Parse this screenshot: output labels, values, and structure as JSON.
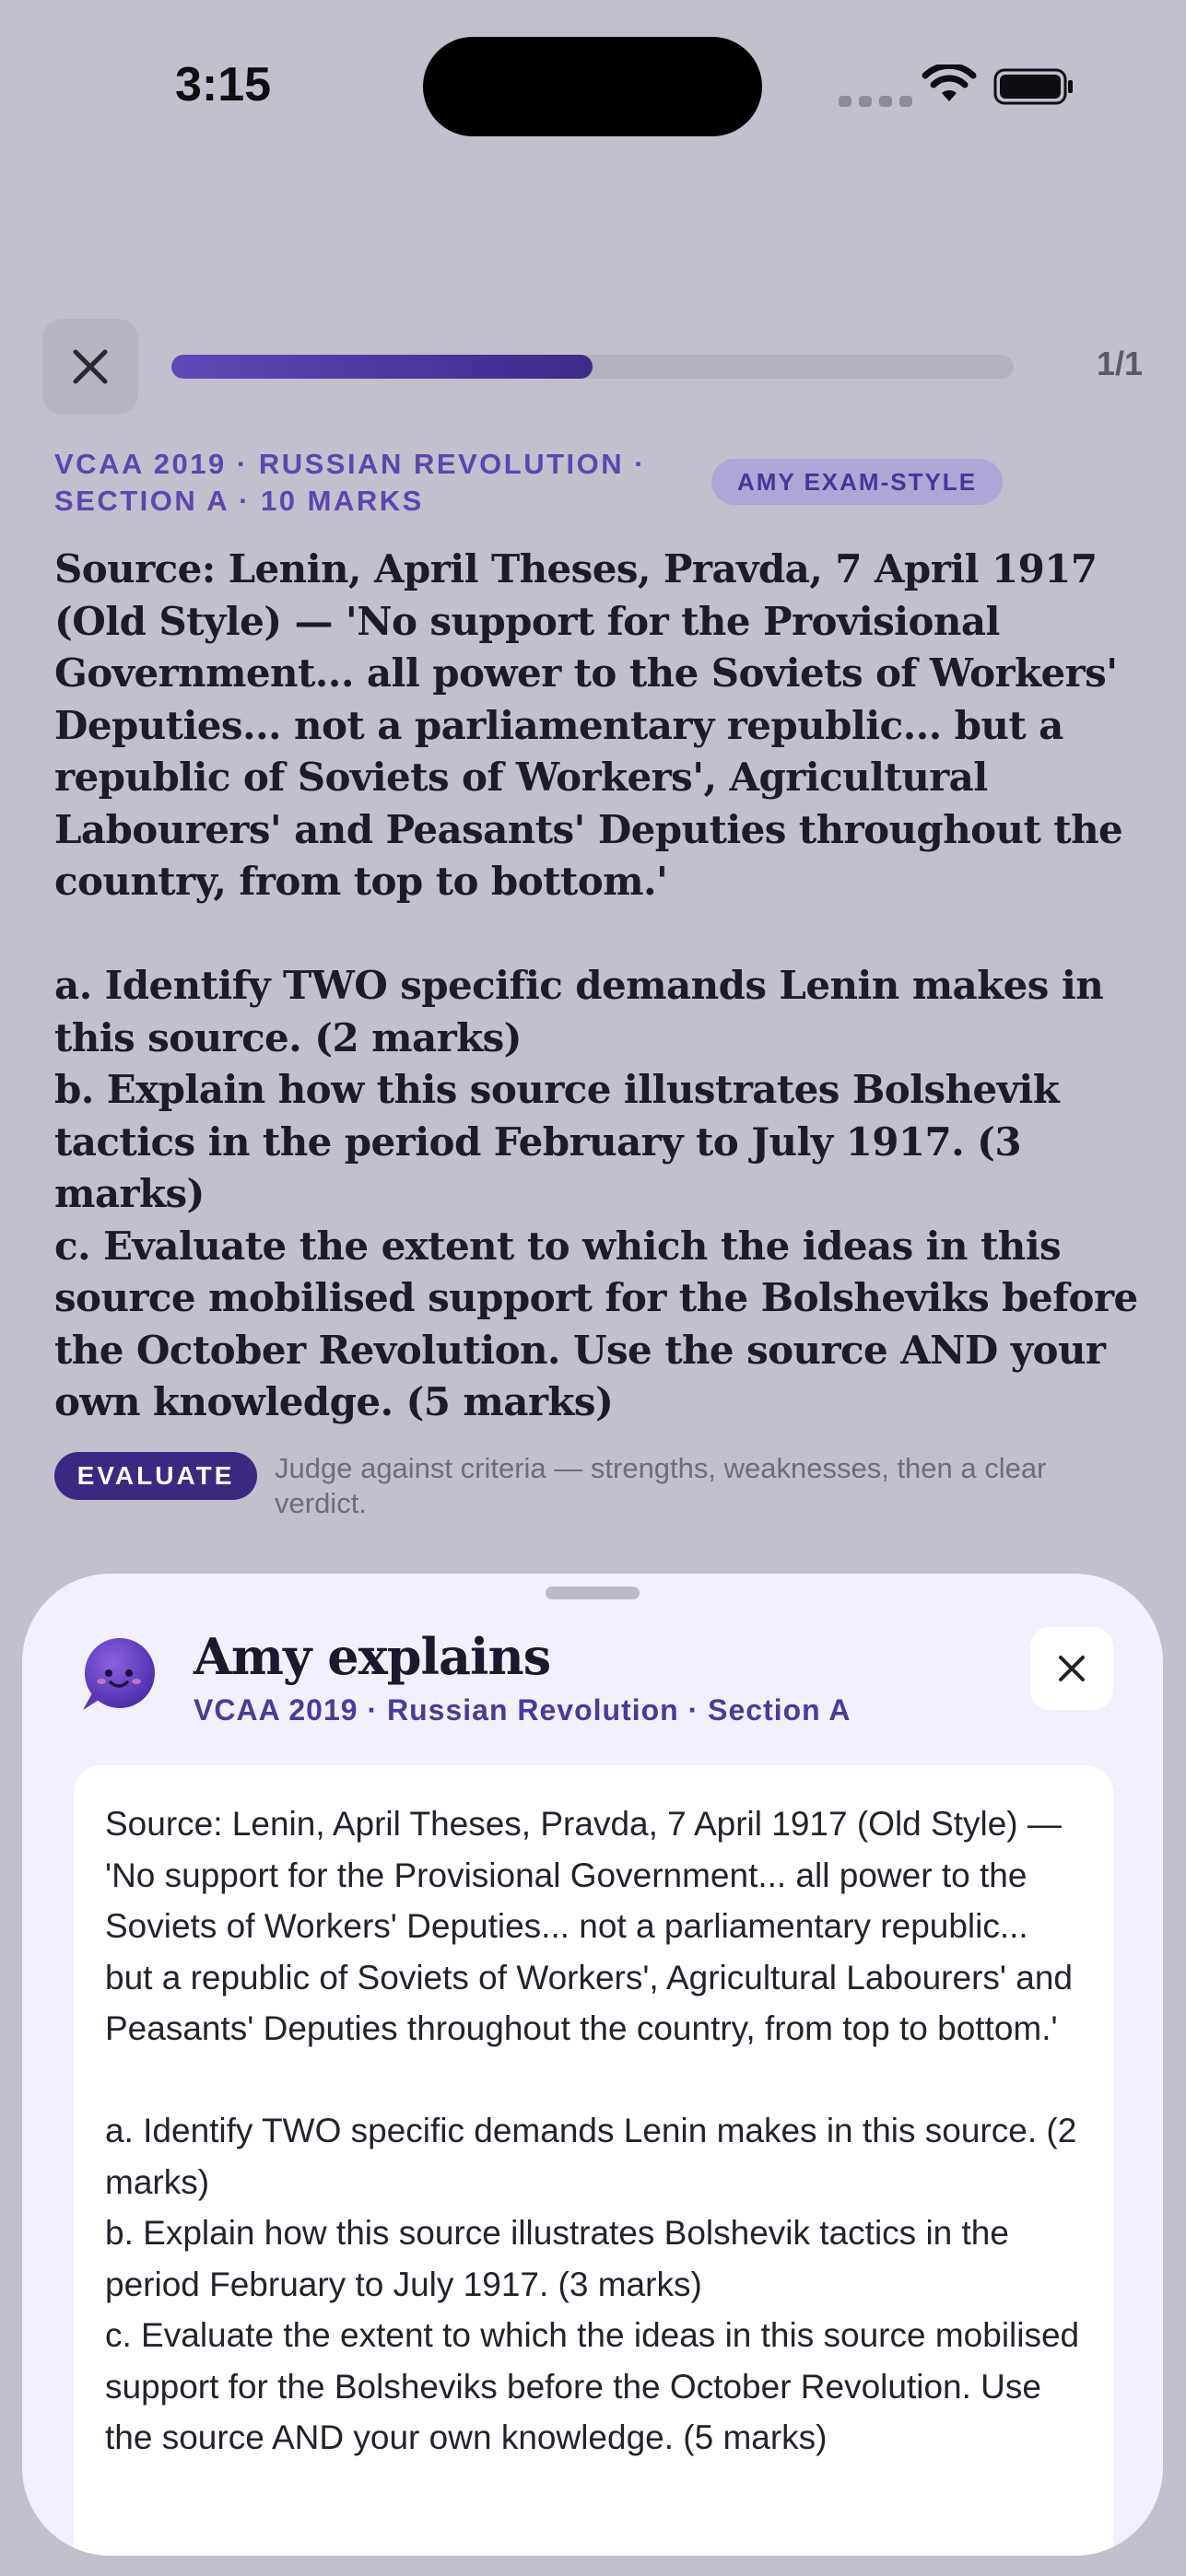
{
  "status_bar": {
    "time": "3:15",
    "icons": [
      "signal-dots-icon",
      "wifi-icon",
      "battery-icon"
    ]
  },
  "header": {
    "close_icon": "close-icon",
    "progress_fraction": 0.5,
    "progress_count": "1/1"
  },
  "question": {
    "meta": "VCAA 2019 · RUSSIAN REVOLUTION · SECTION A · 10 MARKS",
    "badge": "AMY EXAM-STYLE",
    "text": "Source: Lenin, April Theses, Pravda, 7 April 1917 (Old Style) — 'No support for the Provisional Government... all power to the Soviets of Workers' Deputies... not a parliamentary republic... but a republic of Soviets of Workers', Agricultural Labourers' and Peasants' Deputies throughout the country, from top to bottom.'\n\na. Identify TWO specific demands Lenin makes in this source. (2 marks)\nb. Explain how this source illustrates Bolshevik tactics in the period February to July 1917. (3 marks)\nc. Evaluate the extent to which the ideas in this source mobilised support for the Bolsheviks before the October Revolution. Use the source AND your own knowledge. (5 marks)",
    "command_term": "EVALUATE",
    "command_hint": "Judge against criteria — strengths, weaknesses, then a clear verdict."
  },
  "sheet": {
    "title": "Amy explains",
    "subtitle": "VCAA 2019 · Russian Revolution · Section A",
    "close_icon": "close-icon",
    "body": "Source: Lenin, April Theses, Pravda, 7 April 1917 (Old Style) — 'No support for the Provisional Government... all power to the Soviets of Workers' Deputies... not a parliamentary republic... but a republic of Soviets of Workers', Agricultural Labourers' and Peasants' Deputies throughout the country, from top to bottom.'\n\na. Identify TWO specific demands Lenin makes in this source. (2 marks)\nb. Explain how this source illustrates Bolshevik tactics in the period February to July 1917. (3 marks)\nc. Evaluate the extent to which the ideas in this source mobilised support for the Bolsheviks before the October Revolution. Use the source AND your own knowledge. (5 marks)"
  },
  "colors": {
    "accent": "#5d46ad",
    "accent_dark": "#3b2880",
    "background": "#c2c0cc",
    "sheet": "#f3f0fd"
  }
}
